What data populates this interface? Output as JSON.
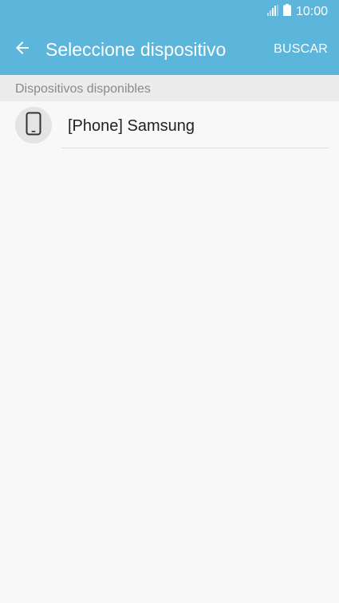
{
  "status_bar": {
    "time": "10:00",
    "signal_icon": "signal-icon",
    "battery_icon": "battery-icon"
  },
  "app_bar": {
    "back_icon": "back-arrow-icon",
    "title": "Seleccione dispositivo",
    "action_label": "BUSCAR"
  },
  "section": {
    "header": "Dispositivos disponibles"
  },
  "devices": [
    {
      "name": "[Phone] Samsung",
      "icon": "phone-icon"
    }
  ],
  "colors": {
    "accent": "#5cb5db",
    "background": "#f8f8f8",
    "section_header_bg": "#ececec"
  }
}
